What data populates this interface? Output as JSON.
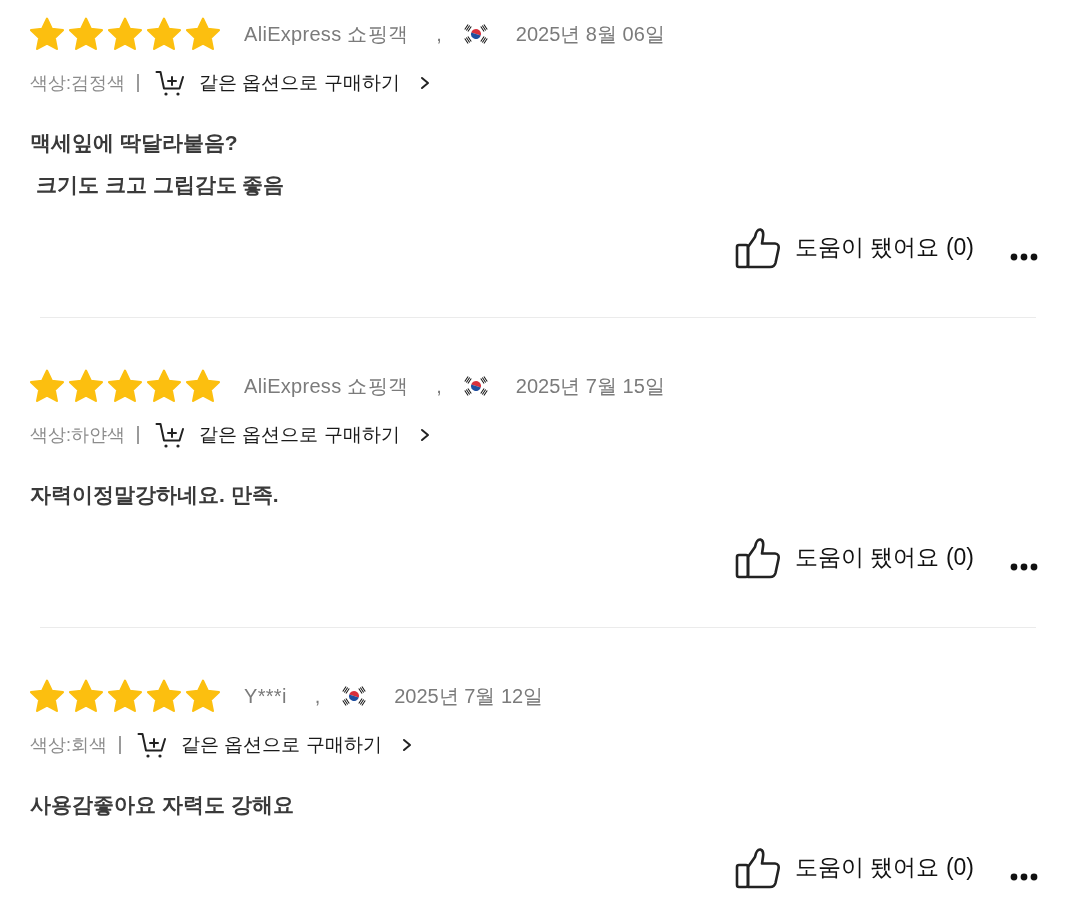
{
  "reviews": [
    {
      "stars": 5,
      "author": "AliExpress 쇼핑객",
      "comma": ",",
      "date": "2025년 8월 06일",
      "option": "색상:검정색",
      "buy_same_option": "같은 옵션으로 구매하기",
      "text": "맥세잎에 딱달라붙음?\n 크기도 크고 그립감도 좋음",
      "helpful": "도움이 됐어요 (0)"
    },
    {
      "stars": 5,
      "author": "AliExpress 쇼핑객",
      "comma": ",",
      "date": "2025년 7월 15일",
      "option": "색상:하얀색",
      "buy_same_option": "같은 옵션으로 구매하기",
      "text": "자력이정말강하네요. 만족.",
      "helpful": "도움이 됐어요 (0)"
    },
    {
      "stars": 5,
      "author": "Y***i",
      "comma": ",",
      "date": "2025년 7월 12일",
      "option": "색상:회색",
      "buy_same_option": "같은 옵션으로 구매하기",
      "text": "사용감좋아요 자력도 강해요",
      "helpful": "도움이 됐어요 (0)"
    }
  ]
}
